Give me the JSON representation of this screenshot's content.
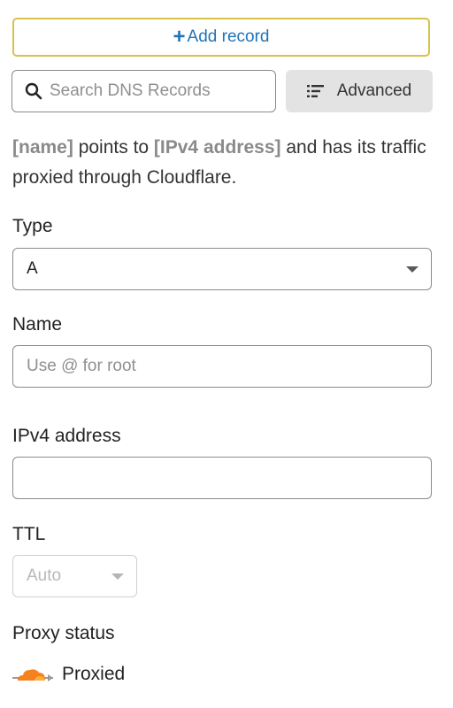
{
  "toolbar": {
    "add_record_label": "Add record",
    "add_icon": "plus-icon",
    "search_placeholder": "Search DNS Records",
    "search_icon": "search-icon",
    "advanced_label": "Advanced",
    "advanced_icon": "list-icon"
  },
  "description": {
    "name_placeholder": "[name]",
    "text1": " points to ",
    "address_placeholder": "[IPv4 address]",
    "text2": " and has its traffic proxied through Cloudflare."
  },
  "form": {
    "type": {
      "label": "Type",
      "value": "A"
    },
    "name": {
      "label": "Name",
      "placeholder": "Use @ for root",
      "value": ""
    },
    "ipv4": {
      "label": "IPv4 address",
      "value": ""
    },
    "ttl": {
      "label": "TTL",
      "value": "Auto",
      "disabled": true
    },
    "proxy": {
      "label": "Proxy status",
      "value": "Proxied",
      "icon": "cloud-proxy-icon",
      "icon_color": "#f6821f"
    }
  },
  "colors": {
    "accent": "#1f74b8",
    "focus_border": "#d8c24a",
    "cloudflare_orange": "#f6821f"
  }
}
